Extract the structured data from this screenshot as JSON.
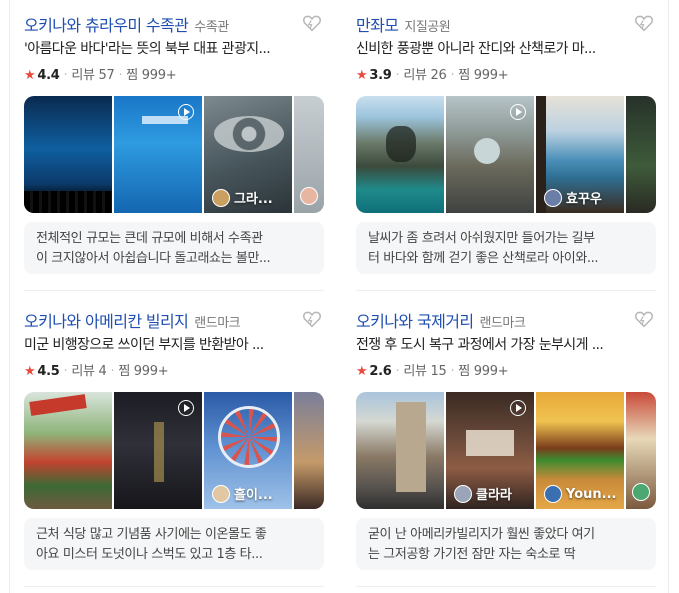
{
  "cards": [
    {
      "title": "오키나와 츄라우미 수족관",
      "category": "수족관",
      "description": "'아름다운 바다'라는 뜻의 북부 대표 관광지...",
      "rating": "4.4",
      "reviews": "리뷰 57",
      "saves": "찜 999+",
      "overlay_label": "그라...",
      "review_lines": [
        "전체적인 규모는 큰데 규모에 비해서 수족관",
        "이 크지않아서 아쉽습니다 돌고래쇼는 볼만..."
      ]
    },
    {
      "title": "만좌모",
      "category": "지질공원",
      "description": "신비한 풍광뿐 아니라 잔디와 산책로가 마...",
      "rating": "3.9",
      "reviews": "리뷰 26",
      "saves": "찜 999+",
      "overlay_label": "효꾸우",
      "review_lines": [
        "날씨가 좀 흐려서 아쉬웠지만 들어가는 길부",
        "터 바다와 함께 걷기 좋은 산책로라 아이와..."
      ]
    },
    {
      "title": "오키나와 아메리칸 빌리지",
      "category": "랜드마크",
      "description": "미군 비행장으로 쓰이던 부지를 반환받아 ...",
      "rating": "4.5",
      "reviews": "리뷰 4",
      "saves": "찜 999+",
      "overlay_label": "흘이...",
      "review_lines": [
        "근처 식당 많고 기념품 사기에는 이온몰도 좋",
        "아요 미스터 도넛이나 스벅도 있고 1층 타..."
      ]
    },
    {
      "title": "오키나와 국제거리",
      "category": "랜드마크",
      "description": "전쟁 후 도시 복구 과정에서 가장 눈부시게 ...",
      "rating": "2.6",
      "reviews": "리뷰 15",
      "saves": "찜 999+",
      "overlay_label": "클라라",
      "overlay_label_2": "Youn...",
      "review_lines": [
        "굳이 난 아메리카빌리지가 훨씬 좋았다 여기",
        "는 그저공항 가기전 잠만 자는 숙소로 딱"
      ]
    }
  ],
  "colors": {
    "title": "#1f4fb0",
    "star": "#e84b3c",
    "review_bg": "#f5f6f7"
  },
  "icons": [
    "heart-icon",
    "star-icon",
    "play-icon",
    "avatar-icon"
  ]
}
